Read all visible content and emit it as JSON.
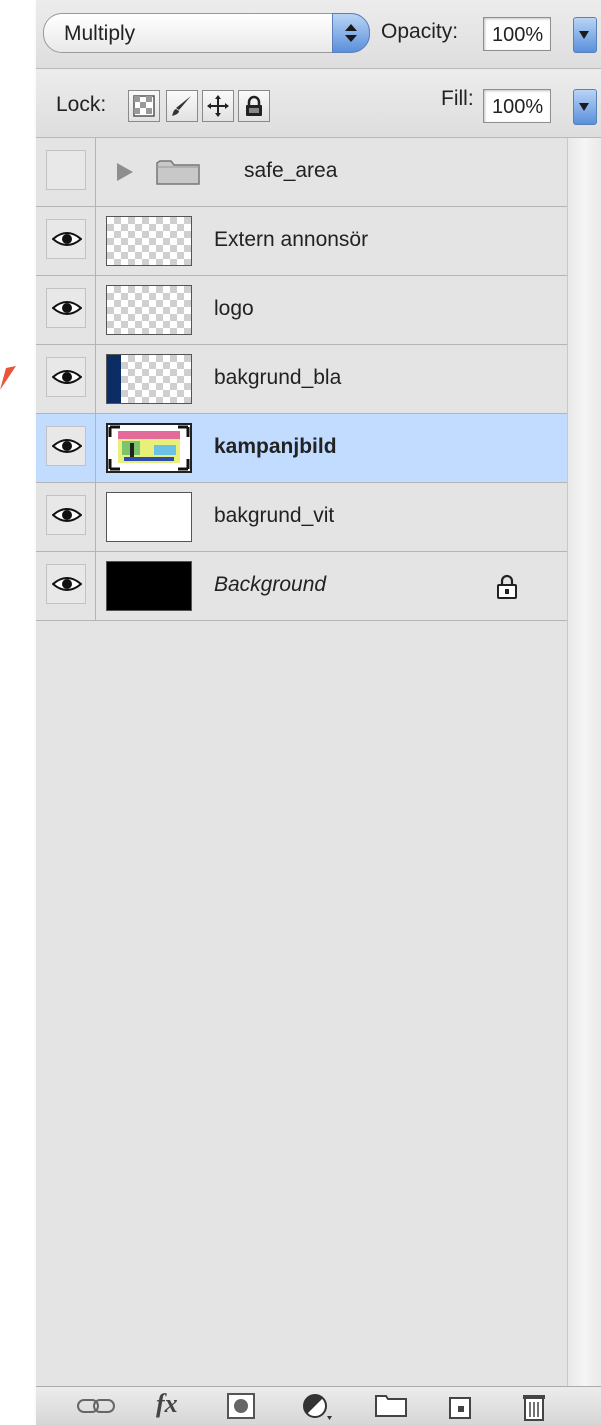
{
  "panel": {
    "blend_mode": "Multiply",
    "opacity_label": "Opacity:",
    "opacity_value": "100%",
    "lock_label": "Lock:",
    "fill_label": "Fill:",
    "fill_value": "100%"
  },
  "layers": [
    {
      "name": "safe_area",
      "type": "group",
      "visible": false,
      "selected": false
    },
    {
      "name": "Extern annonsör",
      "type": "layer",
      "visible": true,
      "selected": false,
      "thumb": "transparent"
    },
    {
      "name": "logo",
      "type": "layer",
      "visible": true,
      "selected": false,
      "thumb": "transparent"
    },
    {
      "name": "bakgrund_bla",
      "type": "layer",
      "visible": true,
      "selected": false,
      "thumb": "transparent-blue-edge"
    },
    {
      "name": "kampanjbild",
      "type": "smart-object",
      "visible": true,
      "selected": true,
      "thumb": "image"
    },
    {
      "name": "bakgrund_vit",
      "type": "layer",
      "visible": true,
      "selected": false,
      "thumb": "white"
    },
    {
      "name": "Background",
      "type": "background",
      "visible": true,
      "selected": false,
      "thumb": "black",
      "locked": true
    }
  ],
  "icons": {
    "lock_buttons": [
      "lock-transparent-icon",
      "lock-image-icon",
      "lock-position-icon",
      "lock-all-icon"
    ],
    "bottom": [
      "link-icon",
      "fx-icon",
      "mask-icon",
      "adjustment-icon",
      "new-group-icon",
      "new-layer-icon",
      "trash-icon"
    ],
    "fx_text": "fx"
  },
  "colors": {
    "selected_row": "#c1dcff",
    "panel_bg": "#e4e4e4",
    "accent_blue": "#5a90db",
    "arrow": "#e8553a"
  }
}
